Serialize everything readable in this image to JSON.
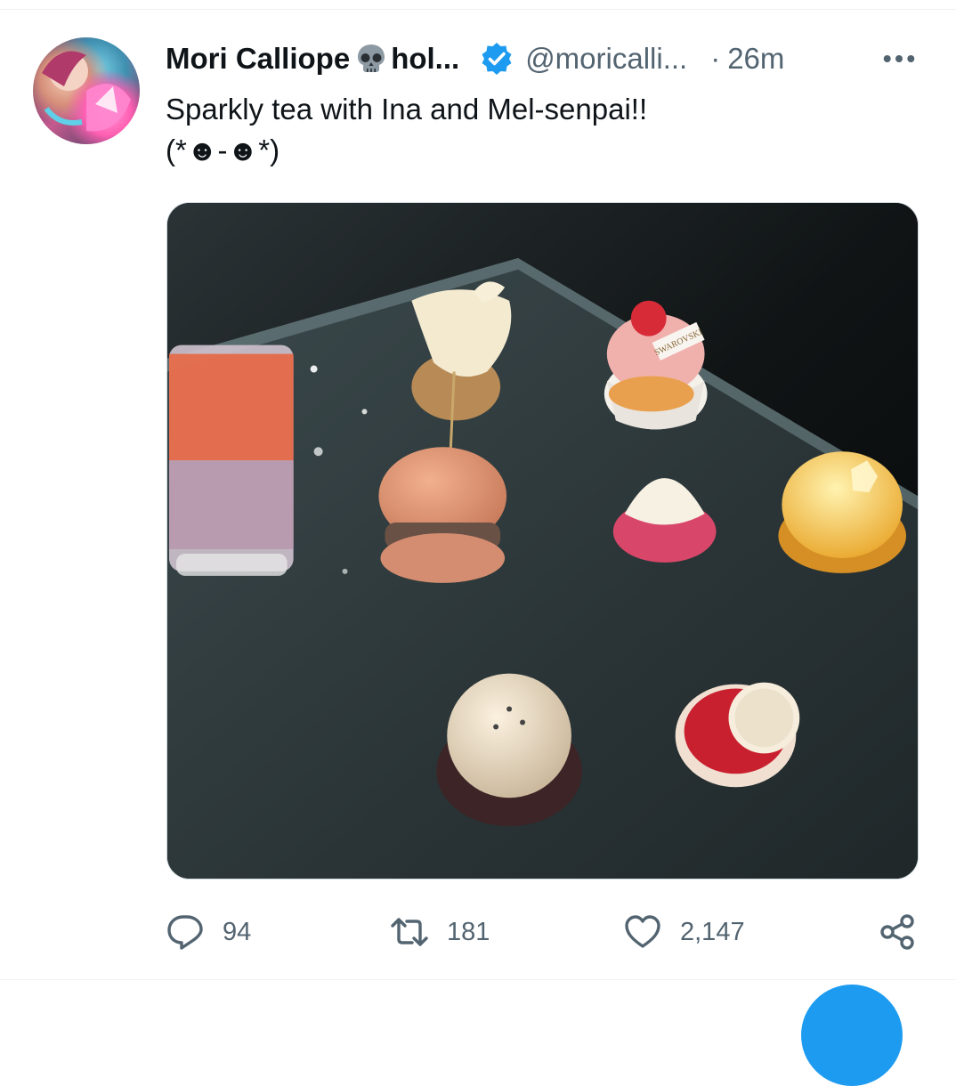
{
  "tweet": {
    "display_name": "Mori Calliope",
    "name_suffix": "hol...",
    "handle": "@moricalli...",
    "separator": "·",
    "timestamp": "26m",
    "text": "Sparkly tea with Ina and Mel-senpai!!\n (*☻-☻*)",
    "verified": true
  },
  "icons": {
    "avatar": "avatar-image",
    "skull": "skull-icon",
    "verified": "verified-badge-icon",
    "more": "more-horizontal-icon",
    "reply": "reply-icon",
    "retweet": "retweet-icon",
    "like": "heart-icon",
    "share": "share-icon"
  },
  "actions": {
    "reply_count": "94",
    "retweet_count": "181",
    "like_count": "2,147"
  },
  "media": {
    "logo_text": "SWAROVSKI"
  },
  "colors": {
    "text": "#0f1419",
    "secondary": "#536471",
    "verified": "#1d9bf0",
    "divider": "#eff3f4"
  }
}
